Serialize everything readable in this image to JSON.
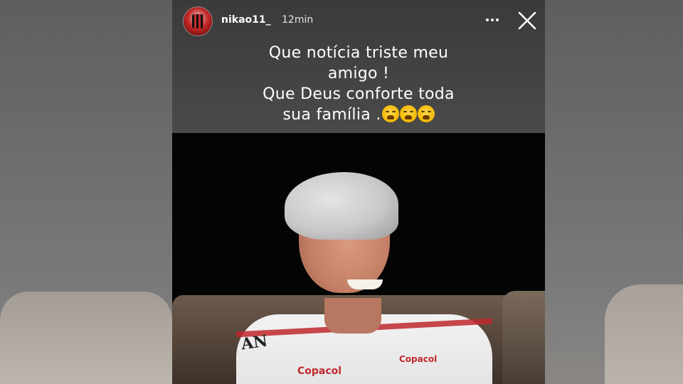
{
  "story": {
    "username": "nikao11_",
    "time": "12min",
    "caption_lines": [
      "Que notícia triste meu",
      "amigo !",
      "Que Deus conforte toda",
      "sua família ."
    ],
    "caption_emojis": [
      "loudly-crying-face",
      "loudly-crying-face",
      "loudly-crying-face"
    ],
    "more_icon": "more-horizontal-icon",
    "close_icon": "close-icon"
  },
  "photo": {
    "shirt_sponsor_left": "Copacol",
    "shirt_sponsor_right": "Copacol",
    "shirt_chest_text": "AN"
  },
  "colors": {
    "caption_bg": "#444444",
    "text": "#ffffff",
    "photo_bg": "#050505",
    "sponsor": "#c0282d"
  }
}
